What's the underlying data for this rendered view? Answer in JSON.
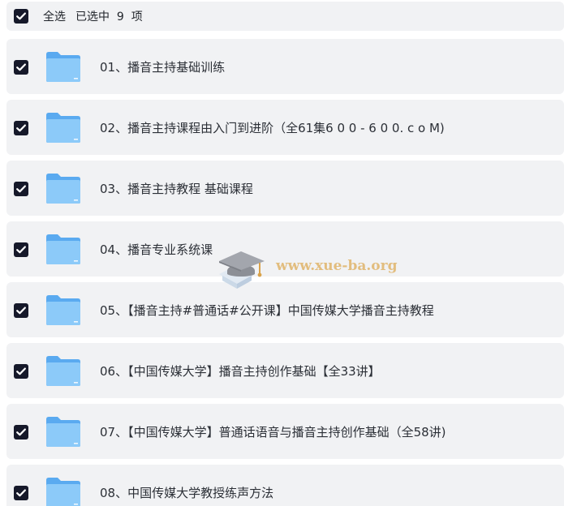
{
  "header": {
    "select_all_label": "全选",
    "selected_text": "已选中  9  项"
  },
  "items": [
    {
      "label": "01、播音主持基础训练"
    },
    {
      "label": "02、播音主持课程由入门到进阶（全61集6 0 0 - 6 0 0. c o M)"
    },
    {
      "label": "03、播音主持教程 基础课程"
    },
    {
      "label": "04、播音专业系统课"
    },
    {
      "label": "05、【播音主持#普通话#公开课】中国传媒大学播音主持教程"
    },
    {
      "label": "06、【中国传媒大学】播音主持创作基础【全33讲】"
    },
    {
      "label": "07、【中国传媒大学】普通话语音与播音主持创作基础（全58讲)"
    },
    {
      "label": "08、中国传媒大学教授练声方法"
    }
  ],
  "watermark": {
    "text": "www.xue-ba.org"
  },
  "colors": {
    "row_bg": "#f1f2f4",
    "checkbox": "#16192a",
    "folder_back": "#5aaaf0",
    "folder_front": "#8ccaf9",
    "watermark": "#e0b46a"
  }
}
